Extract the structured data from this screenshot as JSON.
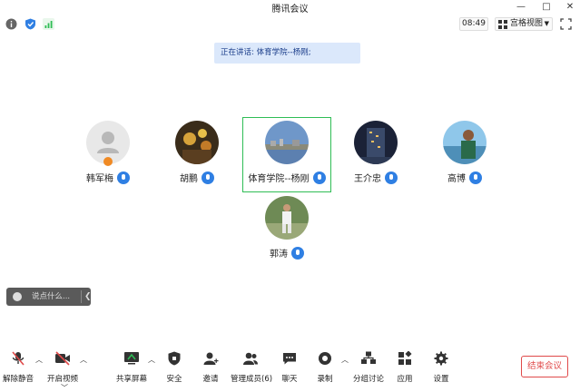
{
  "window": {
    "title": "腾讯会议",
    "controls": [
      "—",
      "□",
      "✕"
    ]
  },
  "status": {
    "time": "08:49",
    "view_label": "宫格视图"
  },
  "speaking": {
    "text": "正在讲话: 体育学院--杨刚;"
  },
  "participants": [
    {
      "name": "韩军梅",
      "avatar": "default-avatar",
      "host": true,
      "mic_on": true
    },
    {
      "name": "胡鹏",
      "avatar": "photo-avatar",
      "host": false,
      "mic_on": true
    },
    {
      "name": "体育学院--杨刚",
      "avatar": "photo-avatar",
      "host": false,
      "mic_on": true,
      "active": true
    },
    {
      "name": "王介忠",
      "avatar": "photo-avatar",
      "host": false,
      "mic_on": true
    },
    {
      "name": "高博",
      "avatar": "photo-avatar",
      "host": false,
      "mic_on": true
    },
    {
      "name": "郭涛",
      "avatar": "photo-avatar",
      "host": false,
      "mic_on": true
    }
  ],
  "chat": {
    "placeholder": "说点什么..."
  },
  "toolbar": {
    "unmute": "解除静音",
    "video": "开启视频",
    "share": "共享屏幕",
    "security": "安全",
    "invite": "邀请",
    "members": "管理成员(6)",
    "chat": "聊天",
    "record": "录制",
    "breakout": "分组讨论",
    "apps": "应用",
    "settings": "设置",
    "end": "结束会议"
  },
  "colors": {
    "accent": "#2f7fe3",
    "active_border": "#2fbd55",
    "end": "#e04a4a",
    "banner_bg": "#dbe8fb"
  }
}
